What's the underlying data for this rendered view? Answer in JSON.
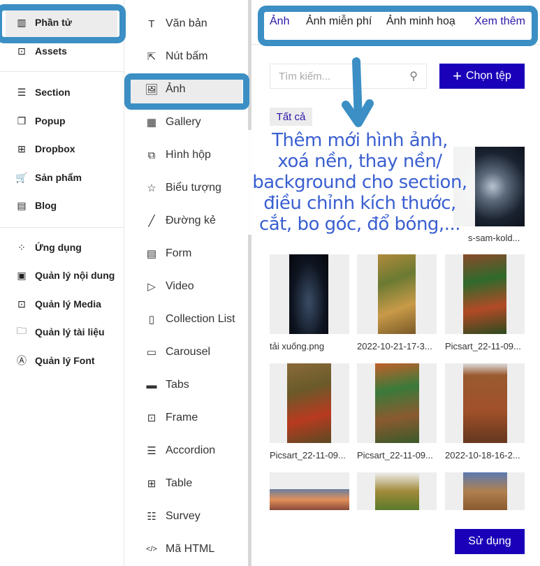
{
  "sidebar": {
    "items": [
      {
        "label": "Phần tử",
        "icon": "elements-icon",
        "active": true
      },
      {
        "label": "Assets",
        "icon": "bookmark-icon"
      },
      {
        "label": "Section",
        "icon": "section-icon"
      },
      {
        "label": "Popup",
        "icon": "popup-icon"
      },
      {
        "label": "Dropbox",
        "icon": "dropbox-icon"
      },
      {
        "label": "Sản phẩm",
        "icon": "cart-icon"
      },
      {
        "label": "Blog",
        "icon": "blog-icon"
      },
      {
        "label": "Ứng dụng",
        "icon": "apps-icon"
      },
      {
        "label": "Quản lý nội dung",
        "icon": "content-icon"
      },
      {
        "label": "Quản lý Media",
        "icon": "media-icon"
      },
      {
        "label": "Quản lý tài liệu",
        "icon": "folder-icon"
      },
      {
        "label": "Quản lý Font",
        "icon": "font-icon"
      }
    ]
  },
  "elements": {
    "items": [
      {
        "label": "Văn bản",
        "icon": "text-icon"
      },
      {
        "label": "Nút bấm",
        "icon": "button-icon"
      },
      {
        "label": "Ảnh",
        "icon": "image-icon",
        "active": true
      },
      {
        "label": "Gallery",
        "icon": "gallery-icon"
      },
      {
        "label": "Hình hộp",
        "icon": "shape-icon"
      },
      {
        "label": "Biểu tượng",
        "icon": "star-icon"
      },
      {
        "label": "Đường kẻ",
        "icon": "line-icon"
      },
      {
        "label": "Form",
        "icon": "form-icon"
      },
      {
        "label": "Video",
        "icon": "video-icon"
      },
      {
        "label": "Collection List",
        "icon": "collection-icon"
      },
      {
        "label": "Carousel",
        "icon": "carousel-icon"
      },
      {
        "label": "Tabs",
        "icon": "tabs-icon"
      },
      {
        "label": "Frame",
        "icon": "frame-icon"
      },
      {
        "label": "Accordion",
        "icon": "accordion-icon"
      },
      {
        "label": "Table",
        "icon": "table-icon"
      },
      {
        "label": "Survey",
        "icon": "survey-icon"
      },
      {
        "label": "Mã HTML",
        "icon": "code-icon"
      }
    ]
  },
  "panel": {
    "tabs": [
      "Ảnh",
      "Ảnh miễn phí",
      "Ảnh minh hoạ",
      "Xem thêm"
    ],
    "search_placeholder": "Tìm kiếm...",
    "upload_label": "Chọn tệp",
    "filter_chip": "Tất cả",
    "files": [
      "s-sam-kold...",
      "tải xuống.png",
      "2022-10-21-17-3...",
      "Picsart_22-11-09...",
      "Picsart_22-11-09...",
      "Picsart_22-11-09...",
      "2022-10-18-16-2..."
    ],
    "use_label": "Sử dụng"
  },
  "annotation": {
    "lines": [
      "Thêm mới hình ảnh,",
      "xoá nền, thay nền/",
      "background cho section,",
      "điều chỉnh kích thước,",
      "cắt, bo góc, đổ bóng,..."
    ]
  },
  "colors": {
    "primary": "#1a00b8",
    "annotation": "#3b8fc4",
    "annotation_text": "#3a5fd0",
    "tab_active": "#2a16a8"
  }
}
